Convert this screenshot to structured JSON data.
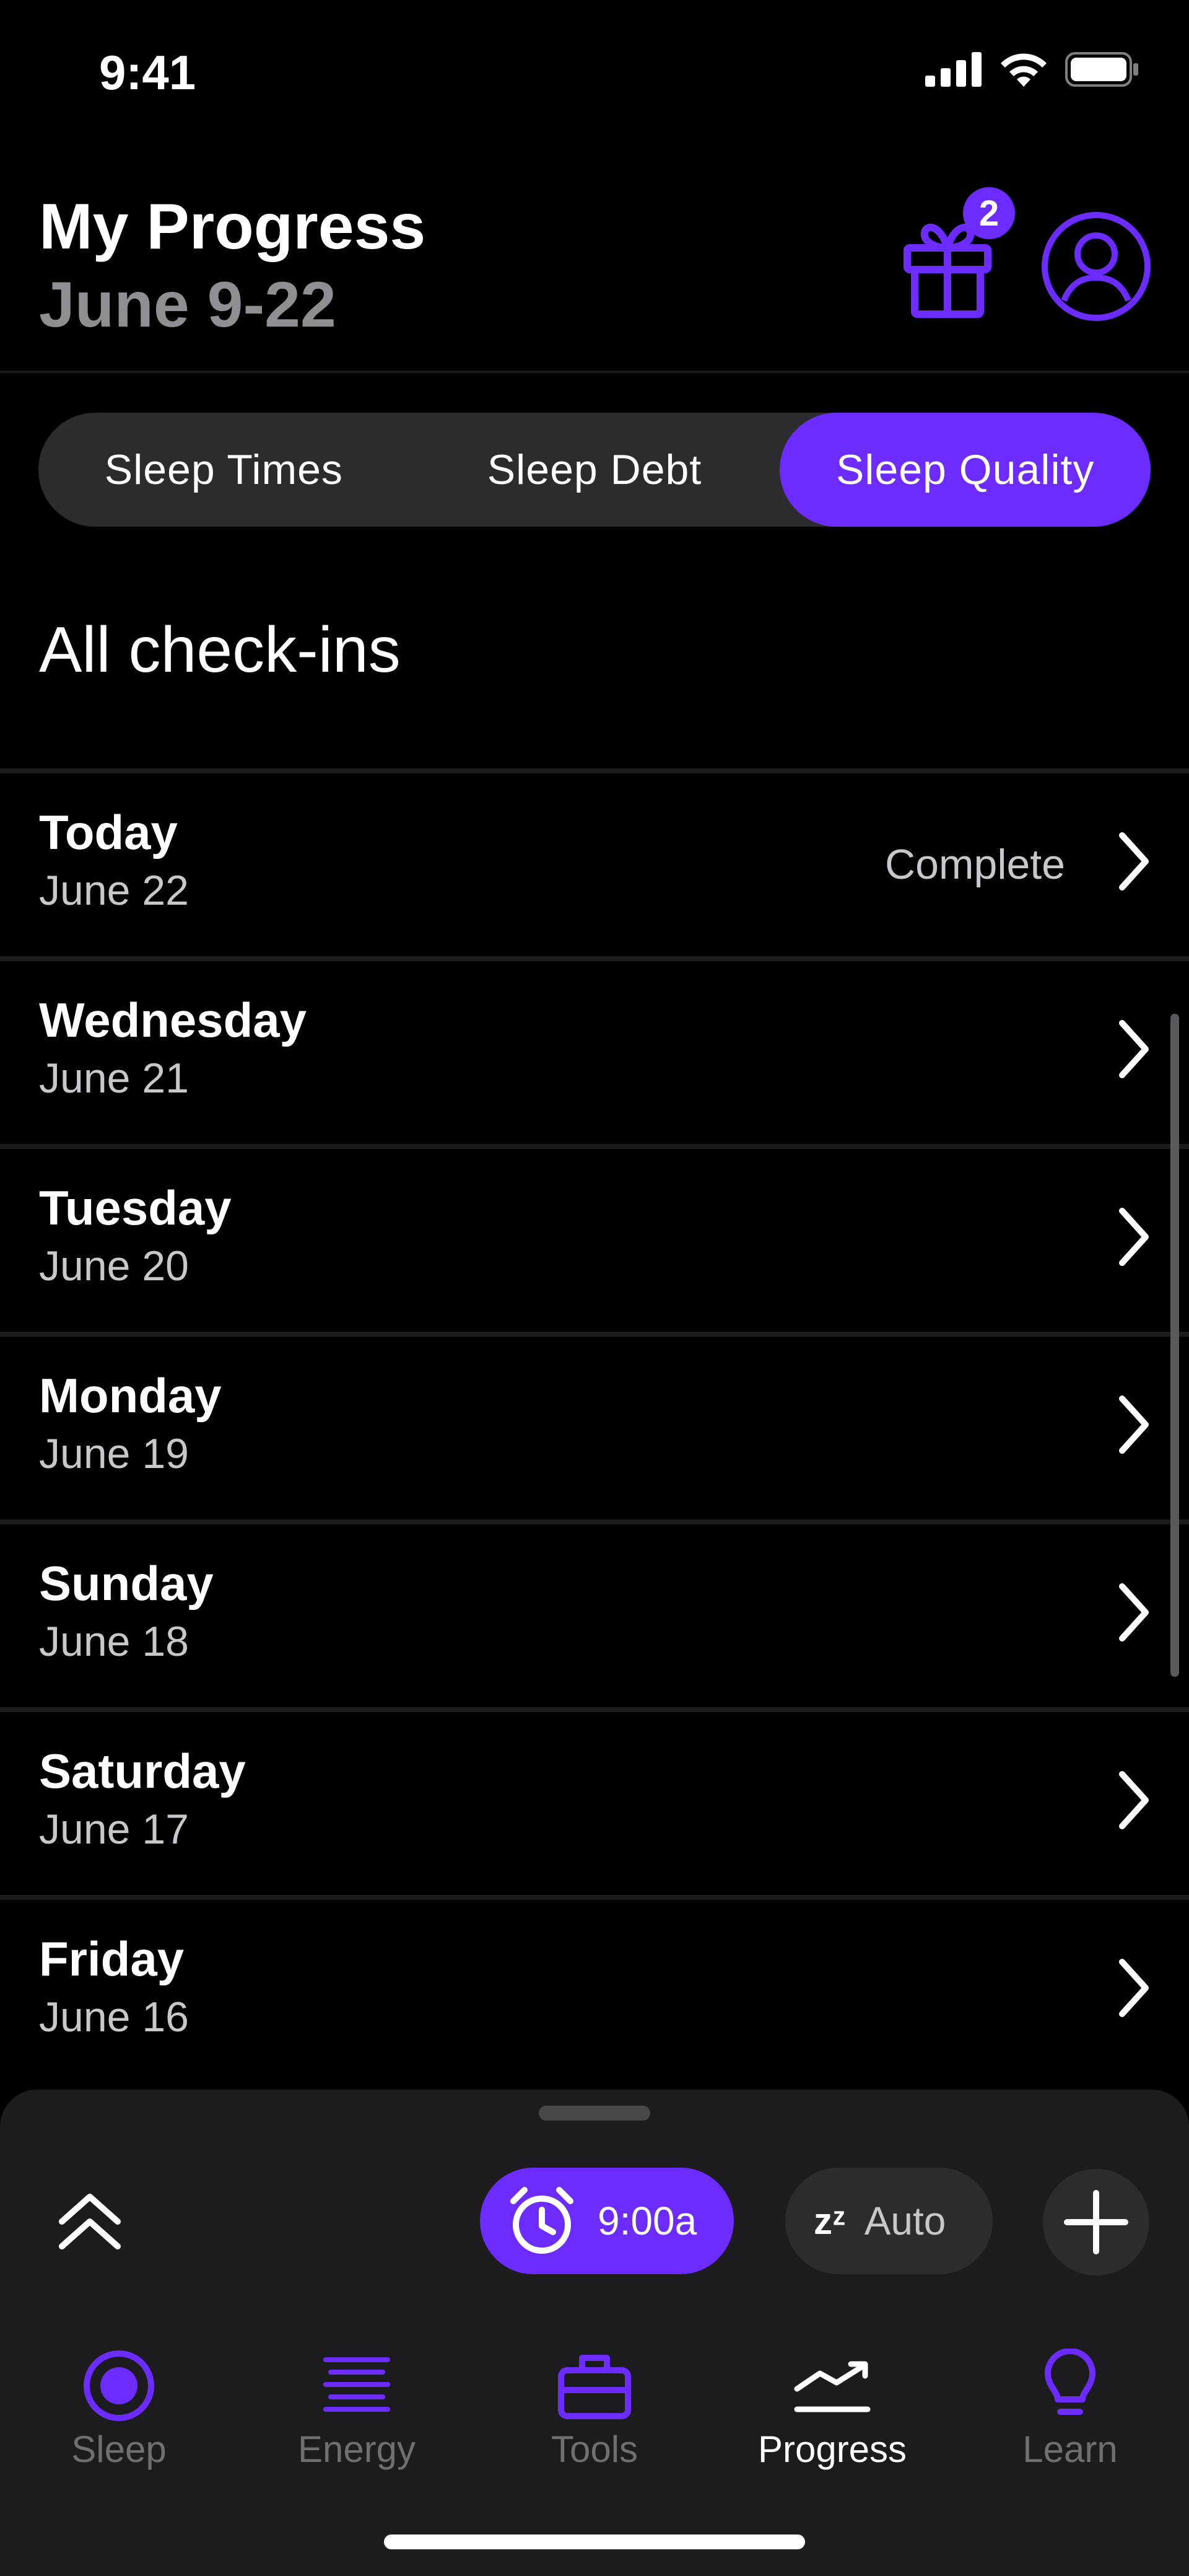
{
  "status_bar": {
    "time": "9:41"
  },
  "header": {
    "title": "My Progress",
    "date_range": "June 9-22",
    "gift_badge_count": "2",
    "icons": [
      "gift-icon",
      "profile-icon"
    ]
  },
  "segments": {
    "items": [
      {
        "label": "Sleep Times",
        "active": false
      },
      {
        "label": "Sleep Debt",
        "active": false
      },
      {
        "label": "Sleep Quality",
        "active": true
      }
    ]
  },
  "section": {
    "title": "All check-ins"
  },
  "checkins": [
    {
      "day": "Today",
      "date": "June 22",
      "status": "Complete"
    },
    {
      "day": "Wednesday",
      "date": "June 21",
      "status": ""
    },
    {
      "day": "Tuesday",
      "date": "June 20",
      "status": ""
    },
    {
      "day": "Monday",
      "date": "June 19",
      "status": ""
    },
    {
      "day": "Sunday",
      "date": "June 18",
      "status": ""
    },
    {
      "day": "Saturday",
      "date": "June 17",
      "status": ""
    },
    {
      "day": "Friday",
      "date": "June 16",
      "status": ""
    }
  ],
  "controls": {
    "alarm_time": "9:00a",
    "auto_label": "Auto",
    "zz_glyph": "zᶻ"
  },
  "tabs": [
    {
      "label": "Sleep",
      "icon": "sleep-icon",
      "active": false
    },
    {
      "label": "Energy",
      "icon": "energy-icon",
      "active": false
    },
    {
      "label": "Tools",
      "icon": "tools-icon",
      "active": false
    },
    {
      "label": "Progress",
      "icon": "progress-icon",
      "active": true
    },
    {
      "label": "Learn",
      "icon": "learn-icon",
      "active": false
    }
  ],
  "colors": {
    "accent": "#6c2bff",
    "background": "#000000",
    "panel": "#1c1c1e"
  }
}
